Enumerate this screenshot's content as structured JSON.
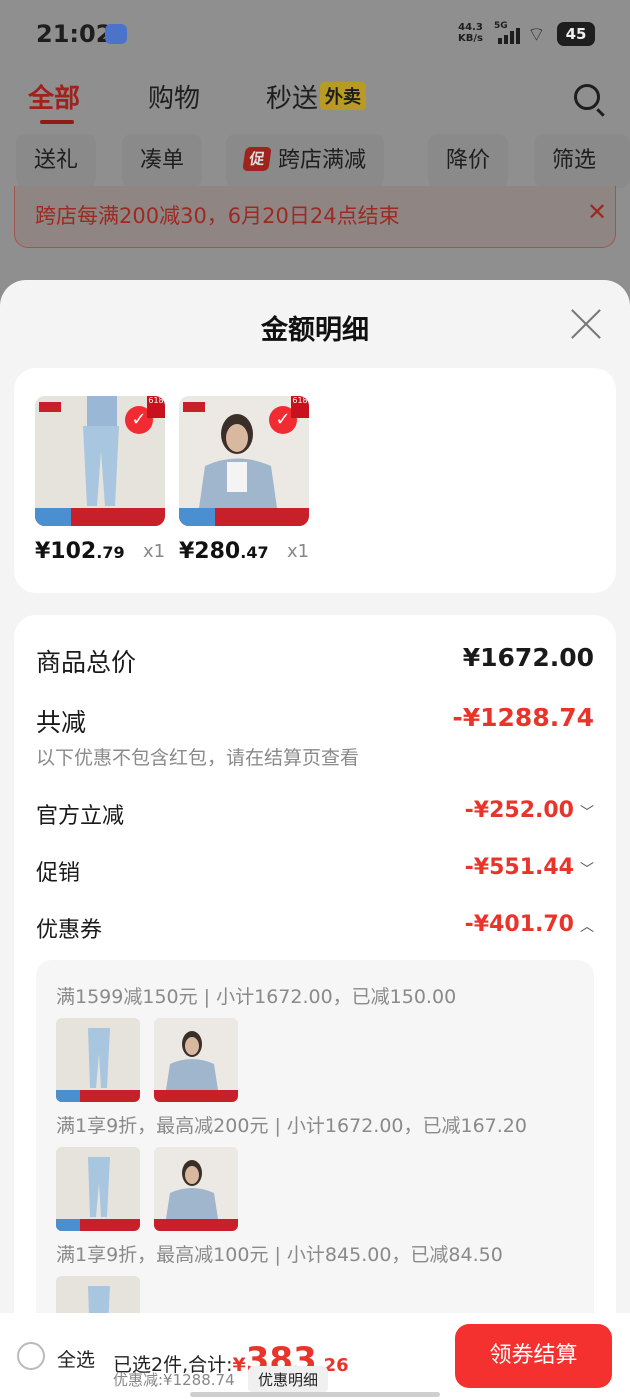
{
  "status_bar": {
    "time": "21:02",
    "net_speed_value": "44.3",
    "net_speed_unit": "KB/s",
    "signal": "5G",
    "battery": "45"
  },
  "top_tabs": [
    {
      "label": "全部",
      "active": true
    },
    {
      "label": "购物",
      "active": false
    },
    {
      "label": "秒送",
      "active": false,
      "badge": "外卖"
    }
  ],
  "filter_chips": [
    "送礼",
    "凑单",
    "跨店满减",
    "降价",
    "筛选"
  ],
  "promo_chip_icon": "促",
  "banner": {
    "text": "跨店每满200减30，6月20日24点结束"
  },
  "sheet": {
    "title": "金额明细",
    "products": [
      {
        "price_int": "¥102",
        "price_dec": ".79",
        "qty": "x1",
        "image": "jeans-model-photo"
      },
      {
        "price_int": "¥280",
        "price_dec": ".47",
        "qty": "x1",
        "image": "denim-jacket-model-photo"
      }
    ],
    "summary": {
      "total_label": "商品总价",
      "total_value": "¥1672.00",
      "reduce_label": "共减",
      "reduce_value": "-¥1288.74",
      "note": "以下优惠不包含红包，请在结算页查看",
      "rows": [
        {
          "label": "官方立减",
          "value": "-¥252.00",
          "expanded": false
        },
        {
          "label": "促销",
          "value": "-¥551.44",
          "expanded": false
        },
        {
          "label": "优惠券",
          "value": "-¥401.70",
          "expanded": true
        }
      ]
    },
    "coupons": [
      "满1599减150元 | 小计1672.00，已减150.00",
      "满1享9折，最高减200元 | 小计1672.00，已减167.20",
      "满1享9折，最高减100元 | 小计845.00，已减84.50"
    ]
  },
  "bottom_bar": {
    "select_all": "全选",
    "selected_text": "已选2件,合计:",
    "currency": "¥",
    "amount_int": "383",
    "amount_dec": ".26",
    "discount_text": "优惠减:¥1288.74",
    "detail_label": "优惠明细",
    "checkout_label": "领券结算"
  },
  "colors": {
    "accent": "#e8342a",
    "checkout": "#f5312f",
    "checkmark": "#f02c32"
  }
}
